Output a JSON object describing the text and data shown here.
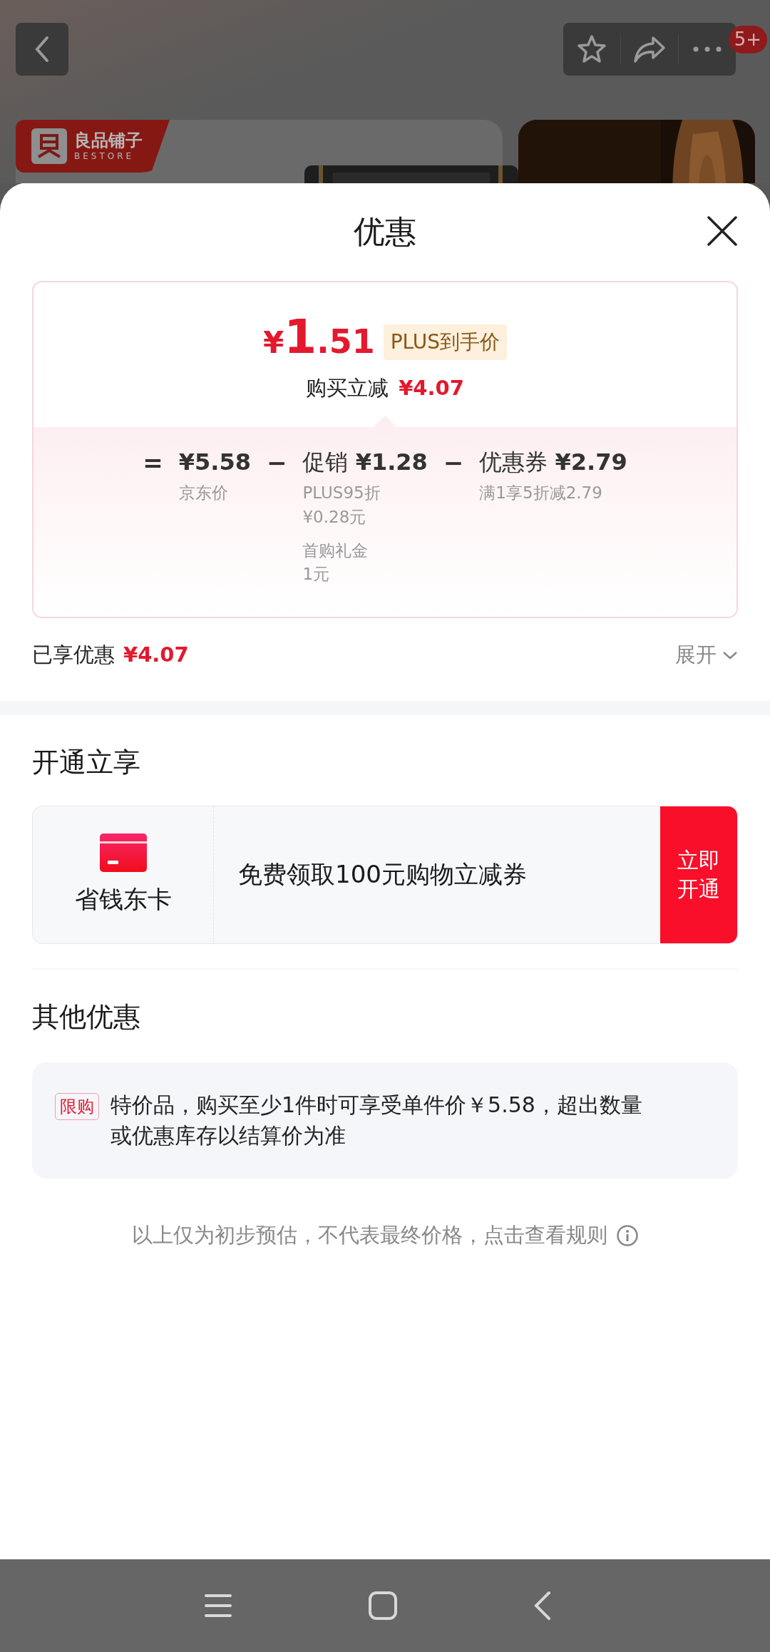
{
  "background_page": {
    "badge": "5+",
    "brand": {
      "name": "良品铺子",
      "subtitle": "BESTORE"
    }
  },
  "sheet": {
    "title": "优惠",
    "price": {
      "currency": "¥",
      "whole": "1",
      "fraction": ".51",
      "tag": "PLUS到手价",
      "saving_label": "购买立减",
      "saving": "¥4.07"
    },
    "breakdown": [
      {
        "operator": "=",
        "amount": "¥5.58",
        "caption": "京东价"
      },
      {
        "operator": "−",
        "label": "促销",
        "amount": "¥1.28",
        "notes": [
          [
            "PLUS95折",
            "¥0.28元"
          ],
          [
            "首购礼金",
            "1元"
          ]
        ]
      },
      {
        "operator": "−",
        "label": "优惠券",
        "amount": "¥2.79",
        "caption": "满1享5折减2.79"
      }
    ],
    "summary": {
      "label": "已享优惠",
      "amount": "¥4.07",
      "toggle": "展开"
    },
    "membership": {
      "heading": "开通立享",
      "card_name": "省钱东卡",
      "offer": "免费领取100元购物立减券",
      "action": "立即开通"
    },
    "other": {
      "heading": "其他优惠",
      "items": [
        {
          "tag": "限购",
          "text": "特价品，购买至少1件时可享受单件价￥5.58，超出数量或优惠库存以结算价为准"
        }
      ]
    },
    "footer_note": "以上仅为初步预估，不代表最终价格，点击查看规则"
  }
}
